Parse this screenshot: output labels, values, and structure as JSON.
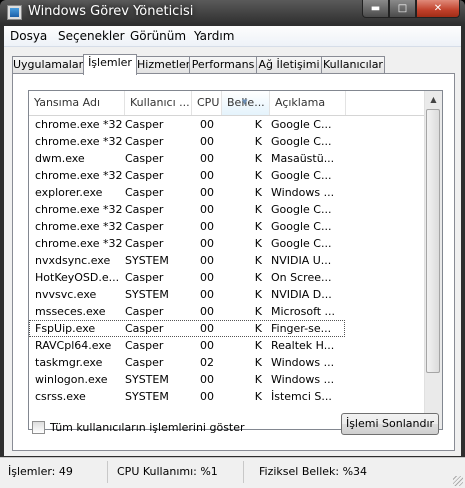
{
  "window": {
    "title": "Windows Görev Yöneticisi",
    "btn_min": "▬",
    "btn_max": "□",
    "btn_close": "✕"
  },
  "menu": [
    "Dosya",
    "Seçenekler",
    "Görünüm",
    "Yardım"
  ],
  "tabs": [
    "Uygulamalar",
    "İşlemler",
    "Hizmetler",
    "Performans",
    "Ağ İletişimi",
    "Kullanıcılar"
  ],
  "active_tab": "İşlemler",
  "columns": [
    "Yansıma Adı",
    "Kullanıcı ...",
    "CPU",
    "Belle...",
    "Açıklama"
  ],
  "sorted_column": "Belle...",
  "rows": [
    [
      "chrome.exe *32",
      "Casper",
      "00",
      "K",
      "Google C..."
    ],
    [
      "chrome.exe *32",
      "Casper",
      "00",
      "K",
      "Google C..."
    ],
    [
      "dwm.exe",
      "Casper",
      "00",
      "K",
      "Masaüstü..."
    ],
    [
      "chrome.exe *32",
      "Casper",
      "00",
      "K",
      "Google C..."
    ],
    [
      "explorer.exe",
      "Casper",
      "00",
      "K",
      "Windows ..."
    ],
    [
      "chrome.exe *32",
      "Casper",
      "00",
      "K",
      "Google C..."
    ],
    [
      "chrome.exe *32",
      "Casper",
      "00",
      "K",
      "Google C..."
    ],
    [
      "chrome.exe *32",
      "Casper",
      "00",
      "K",
      "Google C..."
    ],
    [
      "nvxdsync.exe",
      "SYSTEM",
      "00",
      "K",
      "NVIDIA U..."
    ],
    [
      "HotKeyOSD.e...",
      "Casper",
      "00",
      "K",
      "On Scree..."
    ],
    [
      "nvvsvc.exe",
      "SYSTEM",
      "00",
      "K",
      "NVIDIA D..."
    ],
    [
      "msseces.exe",
      "Casper",
      "00",
      "K",
      "Microsoft ..."
    ],
    [
      "FspUip.exe",
      "Casper",
      "00",
      "K",
      "Finger-se..."
    ],
    [
      "RAVCpl64.exe",
      "Casper",
      "00",
      "K",
      "Realtek H..."
    ],
    [
      "taskmgr.exe",
      "Casper",
      "02",
      "K",
      "Windows ..."
    ],
    [
      "winlogon.exe",
      "SYSTEM",
      "00",
      "K",
      "Windows ..."
    ],
    [
      "csrss.exe",
      "SYSTEM",
      "00",
      "K",
      "İstemci S..."
    ]
  ],
  "selected_row": 12,
  "show_all_label": "Tüm kullanıcıların işlemlerini göster",
  "show_all_checked": false,
  "end_process_label": "İşlemi Sonlandır",
  "status": {
    "processes": "İşlemler: 49",
    "cpu": "CPU Kullanımı: %1",
    "memory": "Fiziksel Bellek: %34"
  }
}
